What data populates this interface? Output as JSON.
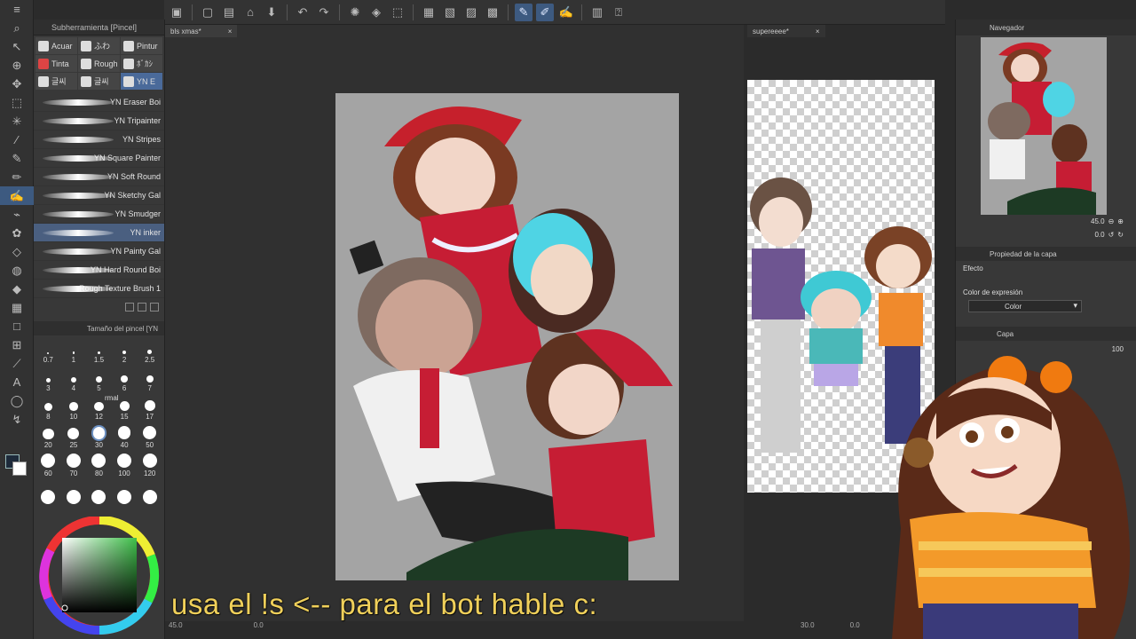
{
  "toolbar": {
    "icons": [
      "menu-icon",
      "new-icon",
      "open-icon",
      "save-icon",
      "undo-icon",
      "redo-icon",
      "spinner-icon",
      "fill-icon",
      "transform-icon",
      "pen-icon",
      "pen-alt-icon",
      "brush-icon",
      "docs-icon",
      "help-icon"
    ]
  },
  "subtool": {
    "panel_title": "Subherramienta [Pincel]",
    "tabs": [
      {
        "label": "Acuar"
      },
      {
        "label": "ふわ"
      },
      {
        "label": "Pintur"
      },
      {
        "label": "Tinta"
      },
      {
        "label": "Rough"
      },
      {
        "label": "ﾎﾞｶｼ"
      },
      {
        "label": "글씨"
      },
      {
        "label": "글씨"
      },
      {
        "label": "YN E"
      }
    ],
    "brushes": [
      {
        "label": "YN Eraser Boi"
      },
      {
        "label": "YN Tripainter"
      },
      {
        "label": "YN Stripes"
      },
      {
        "label": "YN Square Painter"
      },
      {
        "label": "YN Soft Round"
      },
      {
        "label": "YN Sketchy Gal"
      },
      {
        "label": "YN Smudger"
      },
      {
        "label": "YN inker"
      },
      {
        "label": "YN Painty Gal"
      },
      {
        "label": "YN Hard Round Boi"
      },
      {
        "label": "Rough Texture Brush 1"
      }
    ],
    "active_brush": "YN inker"
  },
  "brush_size": {
    "title": "Tamaño del pincel [YN",
    "sizes": [
      "0.7",
      "1",
      "1.5",
      "2",
      "2.5",
      "3",
      "4",
      "5",
      "6",
      "7",
      "8",
      "10",
      "12",
      "15",
      "17",
      "20",
      "25",
      "30",
      "40",
      "50",
      "60",
      "70",
      "80",
      "100",
      "120",
      "",
      "",
      "",
      "",
      ""
    ],
    "active": "30"
  },
  "canvas1": {
    "tab_label": "bls xmas*",
    "tab_close": "×",
    "zoom": "45.0",
    "angle": "0.0"
  },
  "canvas2": {
    "tab_label": "supereeee*",
    "tab_close": "×",
    "zoom": "30.0",
    "angle": "0.0"
  },
  "navigator": {
    "title": "Navegador",
    "zoom": "45.0",
    "angle": "0.0"
  },
  "layer_property": {
    "title": "Propiedad de la capa",
    "effect_label": "Efecto",
    "expression_label": "Color de expresión",
    "expression_value": "Color"
  },
  "layer": {
    "title": "Capa",
    "opacity": "100",
    "blend_mode": "rmal"
  },
  "caption": {
    "text": "usa el !s <-- para el bot hable c:"
  },
  "colors": {
    "accent": "#3d5a80",
    "caption": "#f0d05a",
    "active_color": "#3fbf4a"
  }
}
